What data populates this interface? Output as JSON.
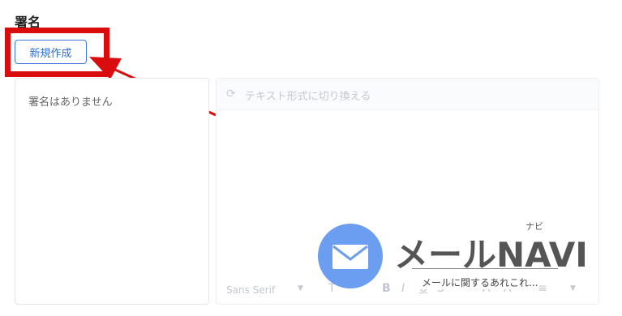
{
  "signature": {
    "title": "署名",
    "new_button_label": "新規作成",
    "empty_message": "署名はありません"
  },
  "editor": {
    "switch_label": "テキスト形式に切り換える",
    "font_select": "Sans Serif",
    "format_buttons": [
      "size-icon",
      "bold-icon",
      "italic-icon",
      "underline-icon",
      "strikethrough-icon",
      "text-color-icon",
      "highlight-icon",
      "align-icon"
    ]
  },
  "watermark": {
    "brand": "メールNAVI",
    "ruby": "ナビ",
    "tagline": "メールに関するあれこれ..."
  },
  "colors": {
    "accent": "#2f6fcf",
    "highlight_frame": "#d90d0d",
    "logo": "#6b9df0"
  }
}
